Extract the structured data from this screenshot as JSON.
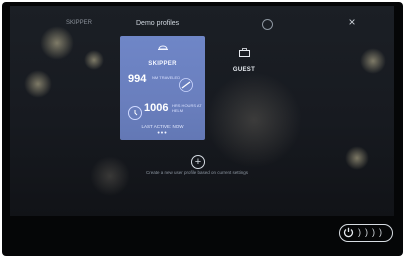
{
  "header": {
    "title": "Demo profiles",
    "corner_label": "SKIPPER",
    "close_icon": "close-icon",
    "settings_icon": "gear-icon"
  },
  "profiles": [
    {
      "name": "SKIPPER",
      "selected": true,
      "stats": [
        {
          "value": "994",
          "label": "NM TRAVELED",
          "icon": "boat-icon"
        },
        {
          "value": "1006",
          "label": "HRS HOURS AT HELM",
          "icon": "clock-icon"
        }
      ],
      "last_active": "LAST ACTIVE: NOW",
      "more": "•••"
    },
    {
      "name": "GUEST",
      "selected": false
    }
  ],
  "add_profile": {
    "icon": "plus-circle-icon",
    "caption": "Create a new user profile based on current settings"
  },
  "power": {
    "icon": "power-icon"
  },
  "colors": {
    "card": "#6f86c7",
    "screen": "#1b1f25",
    "text": "#e6eaef"
  }
}
